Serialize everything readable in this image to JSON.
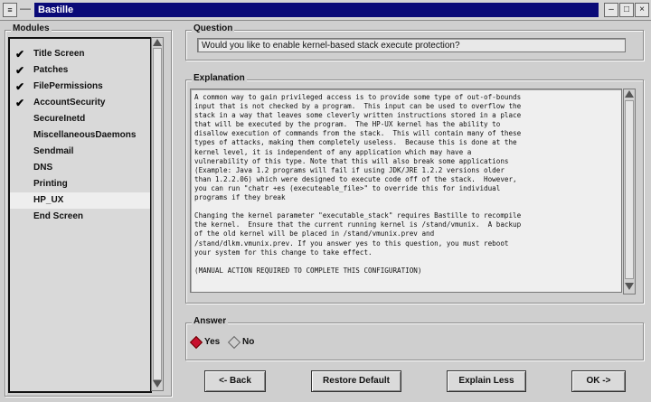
{
  "window": {
    "title": "Bastille",
    "menu_glyph": "≡",
    "minimize": "–",
    "maximize": "□",
    "close": "×"
  },
  "modules": {
    "label": "Modules",
    "items": [
      {
        "label": "Title Screen",
        "checked": true
      },
      {
        "label": "Patches",
        "checked": true
      },
      {
        "label": "FilePermissions",
        "checked": true
      },
      {
        "label": "AccountSecurity",
        "checked": true
      },
      {
        "label": "SecureInetd",
        "checked": false
      },
      {
        "label": "MiscellaneousDaemons",
        "checked": false
      },
      {
        "label": "Sendmail",
        "checked": false
      },
      {
        "label": "DNS",
        "checked": false
      },
      {
        "label": "Printing",
        "checked": false
      },
      {
        "label": "HP_UX",
        "checked": false,
        "selected": true
      },
      {
        "label": "End Screen",
        "checked": false
      }
    ],
    "check_glyph": "✔"
  },
  "question": {
    "label": "Question",
    "text": "Would you like to enable kernel-based stack execute protection?"
  },
  "explanation": {
    "label": "Explanation",
    "text": "A common way to gain privileged access is to provide some type of out-of-bounds\ninput that is not checked by a program.  This input can be used to overflow the\nstack in a way that leaves some cleverly written instructions stored in a place\nthat will be executed by the program.  The HP-UX kernel has the ability to\ndisallow execution of commands from the stack.  This will contain many of these\ntypes of attacks, making them completely useless.  Because this is done at the\nkernel level, it is independent of any application which may have a\nvulnerability of this type. Note that this will also break some applications\n(Example: Java 1.2 programs will fail if using JDK/JRE 1.2.2 versions older\nthan 1.2.2.06) which were designed to execute code off of the stack.  However,\nyou can run \"chatr +es (executeable_file>\" to override this for individual\nprograms if they break\n\nChanging the kernel parameter \"executable_stack\" requires Bastille to recompile\nthe kernel.  Ensure that the current running kernel is /stand/vmunix.  A backup\nof the old kernel will be placed in /stand/vmunix.prev and\n/stand/dlkm.vmunix.prev. If you answer yes to this question, you must reboot\nyour system for this change to take effect.\n\n(MANUAL ACTION REQUIRED TO COMPLETE THIS CONFIGURATION)"
  },
  "answer": {
    "label": "Answer",
    "options": [
      {
        "label": "Yes",
        "selected": true
      },
      {
        "label": "No",
        "selected": false
      }
    ]
  },
  "buttons": {
    "back": "<- Back",
    "restore": "Restore Default",
    "explain_less": "Explain Less",
    "ok": "OK ->"
  }
}
